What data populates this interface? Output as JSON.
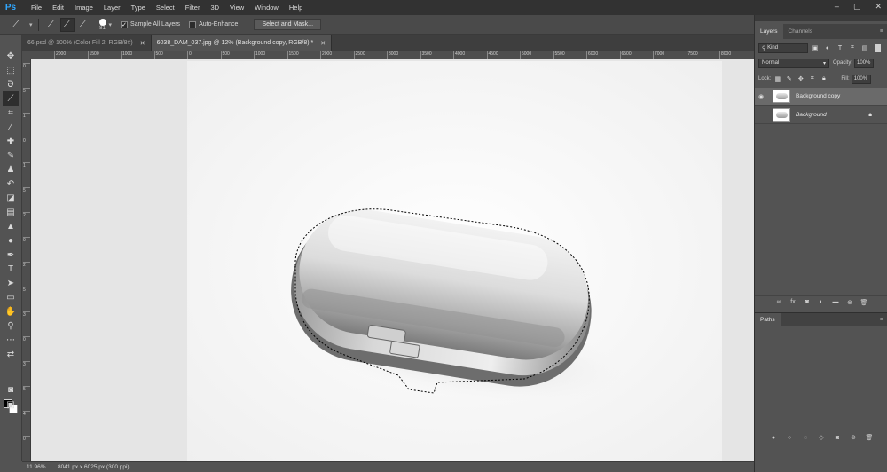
{
  "app": {
    "logo": "Ps",
    "menu": [
      "File",
      "Edit",
      "Image",
      "Layer",
      "Type",
      "Select",
      "Filter",
      "3D",
      "View",
      "Window",
      "Help"
    ],
    "window_controls": [
      "–",
      "▢",
      "✕"
    ]
  },
  "options_bar": {
    "tool_icon": "quick-selection-icon",
    "brush_size": "81",
    "sample_all_layers_label": "Sample All Layers",
    "sample_all_layers_checked": true,
    "auto_enhance_label": "Auto-Enhance",
    "auto_enhance_checked": false,
    "select_and_mask_label": "Select and Mask..."
  },
  "tabs": [
    {
      "label": "66.psd @ 100% (Color Fill 2, RGB/8#)",
      "active": false
    },
    {
      "label": "6038_DAM_037.jpg @ 12% (Background copy, RGB/8) *",
      "active": true
    }
  ],
  "ruler": {
    "h_ticks": [
      "2000",
      "1500",
      "1000",
      "500",
      "0",
      "500",
      "1000",
      "1500",
      "2000",
      "2500",
      "3000",
      "3500",
      "4000",
      "4500",
      "5000",
      "5500",
      "6000",
      "6500",
      "7000",
      "7500",
      "8000"
    ],
    "v_ticks": [
      "0",
      "5",
      "1",
      "0",
      "1",
      "5",
      "2",
      "0",
      "2",
      "5",
      "3",
      "0",
      "3",
      "5",
      "4",
      "0"
    ]
  },
  "status_bar": {
    "zoom": "11.96%",
    "doc_info": "8041 px x 6025 px (300 ppi)"
  },
  "layers_panel": {
    "tabs": [
      "Layers",
      "Channels"
    ],
    "kind_label": "Kind",
    "blend_mode": "Normal",
    "opacity_label": "Opacity:",
    "opacity_value": "100%",
    "lock_label": "Lock:",
    "fill_label": "Fill:",
    "fill_value": "100%",
    "layers": [
      {
        "name": "Background copy",
        "visible": true,
        "selected": true,
        "locked": false
      },
      {
        "name": "Background",
        "visible": false,
        "selected": false,
        "locked": true
      }
    ]
  },
  "paths_panel": {
    "title": "Paths"
  },
  "colors": {
    "accent": "#31a8ff",
    "foreground": "#000000",
    "background": "#ffffff"
  }
}
